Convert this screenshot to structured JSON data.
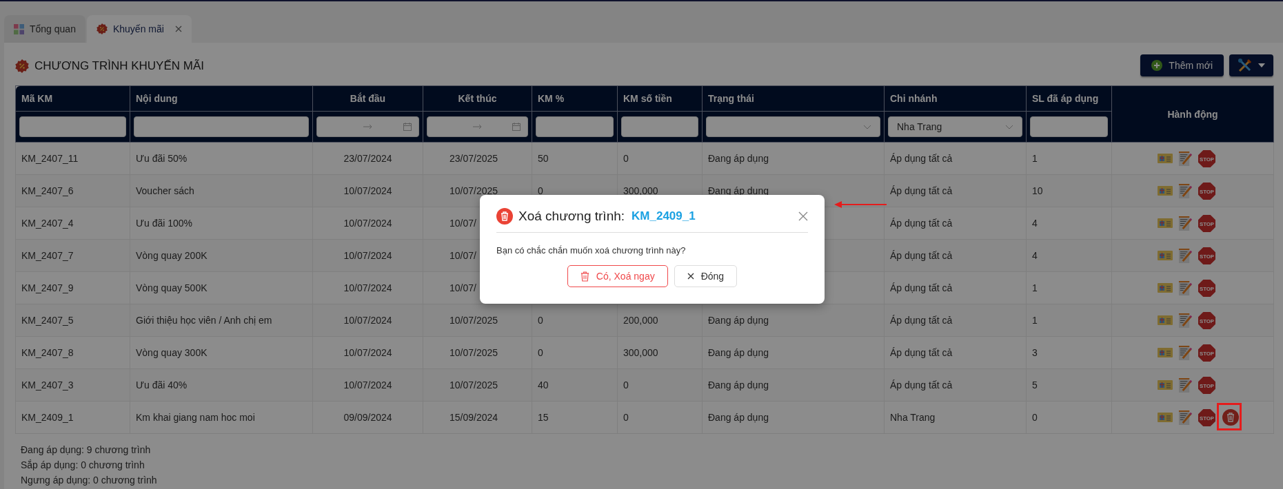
{
  "tabs": [
    {
      "label": "Tổng quan",
      "selected": false
    },
    {
      "label": "Khuyến mãi",
      "selected": true
    }
  ],
  "page_title": "CHƯƠNG TRÌNH KHUYẾN MÃI",
  "toolbar": {
    "add_button": "Thêm mới"
  },
  "table": {
    "columns": [
      {
        "label": "Mã KM",
        "filter": {
          "kind": "text"
        }
      },
      {
        "label": "Nội dung",
        "filter": {
          "kind": "text"
        }
      },
      {
        "label": "Bắt đầu",
        "filter": {
          "kind": "daterange"
        }
      },
      {
        "label": "Kết thúc",
        "filter": {
          "kind": "daterange"
        }
      },
      {
        "label": "KM %",
        "filter": {
          "kind": "text"
        }
      },
      {
        "label": "KM số tiền",
        "filter": {
          "kind": "text"
        }
      },
      {
        "label": "Trạng thái",
        "filter": {
          "kind": "select"
        }
      },
      {
        "label": "Chi nhánh",
        "filter": {
          "kind": "select",
          "value": "Nha Trang"
        }
      },
      {
        "label": "SL đã áp dụng",
        "filter": {
          "kind": "text"
        }
      },
      {
        "label": "Hành động"
      }
    ],
    "rows": [
      {
        "cells": [
          "KM_2407_11",
          "Ưu đãi 50%",
          "23/07/2024",
          "23/07/2025",
          "50",
          "0",
          "Đang áp dụng",
          "Áp dụng tất cả",
          "1"
        ],
        "actions": [
          {
            "kind": "promo"
          },
          {
            "kind": "edit"
          },
          {
            "kind": "stop",
            "label": "STOP"
          }
        ]
      },
      {
        "cells": [
          "KM_2407_6",
          "Voucher sách",
          "10/07/2024",
          "10/07/2025",
          "0",
          "300,000",
          "Đang áp dụng",
          "Áp dụng tất cả",
          "10"
        ],
        "actions": [
          {
            "kind": "promo"
          },
          {
            "kind": "edit"
          },
          {
            "kind": "stop",
            "label": "STOP"
          }
        ]
      },
      {
        "cells": [
          "KM_2407_4",
          "Ưu đãi 100%",
          "10/07/2024",
          "10/07/",
          null,
          null,
          null,
          "Áp dụng tất cả",
          "4"
        ],
        "actions": [
          {
            "kind": "promo"
          },
          {
            "kind": "edit"
          },
          {
            "kind": "stop",
            "label": "STOP"
          }
        ]
      },
      {
        "cells": [
          "KM_2407_7",
          "Vòng quay 200K",
          "10/07/2024",
          "10/07/",
          null,
          null,
          null,
          "Áp dụng tất cả",
          "4"
        ],
        "actions": [
          {
            "kind": "promo"
          },
          {
            "kind": "edit"
          },
          {
            "kind": "stop",
            "label": "STOP"
          }
        ]
      },
      {
        "cells": [
          "KM_2407_9",
          "Vòng quay 500K",
          "10/07/2024",
          "10/07/",
          null,
          null,
          null,
          "Áp dụng tất cả",
          "1"
        ],
        "actions": [
          {
            "kind": "promo"
          },
          {
            "kind": "edit"
          },
          {
            "kind": "stop",
            "label": "STOP"
          }
        ]
      },
      {
        "cells": [
          "KM_2407_5",
          "Giới thiệu học viên / Anh chị em",
          "10/07/2024",
          "10/07/2025",
          "0",
          "200,000",
          "Đang áp dụng",
          "Áp dụng tất cả",
          "1"
        ],
        "actions": [
          {
            "kind": "promo"
          },
          {
            "kind": "edit"
          },
          {
            "kind": "stop",
            "label": "STOP"
          }
        ]
      },
      {
        "cells": [
          "KM_2407_8",
          "Vòng quay 300K",
          "10/07/2024",
          "10/07/2025",
          "0",
          "300,000",
          "Đang áp dụng",
          "Áp dụng tất cả",
          "3"
        ],
        "actions": [
          {
            "kind": "promo"
          },
          {
            "kind": "edit"
          },
          {
            "kind": "stop",
            "label": "STOP"
          }
        ]
      },
      {
        "cells": [
          "KM_2407_3",
          "Ưu đãi 40%",
          "10/07/2024",
          "10/07/2025",
          "40",
          "0",
          "Đang áp dụng",
          "Áp dụng tất cả",
          "5"
        ],
        "actions": [
          {
            "kind": "promo"
          },
          {
            "kind": "edit"
          },
          {
            "kind": "stop",
            "label": "STOP"
          }
        ]
      },
      {
        "cells": [
          "KM_2409_1",
          "Km khai giang nam hoc moi",
          "09/09/2024",
          "15/09/2024",
          "15",
          "0",
          "Đang áp dụng",
          "Nha Trang",
          "0"
        ],
        "actions": [
          {
            "kind": "promo"
          },
          {
            "kind": "edit"
          },
          {
            "kind": "stop",
            "label": "STOP"
          },
          {
            "kind": "delete",
            "highlighted": true
          }
        ]
      }
    ]
  },
  "summary": [
    "Đang áp dụng: 9 chương trình",
    "Sắp áp dụng: 0 chương trình",
    "Ngưng áp dụng: 0 chương trình"
  ],
  "dialog": {
    "title": "Xoá chương trình:",
    "code": "KM_2409_1",
    "message": "Bạn có chắc chắn muốn xoá chương trình này?",
    "buttons": [
      {
        "label": "Có, Xoá ngay",
        "kind": "danger"
      },
      {
        "label": "Đóng",
        "kind": "close"
      }
    ]
  }
}
